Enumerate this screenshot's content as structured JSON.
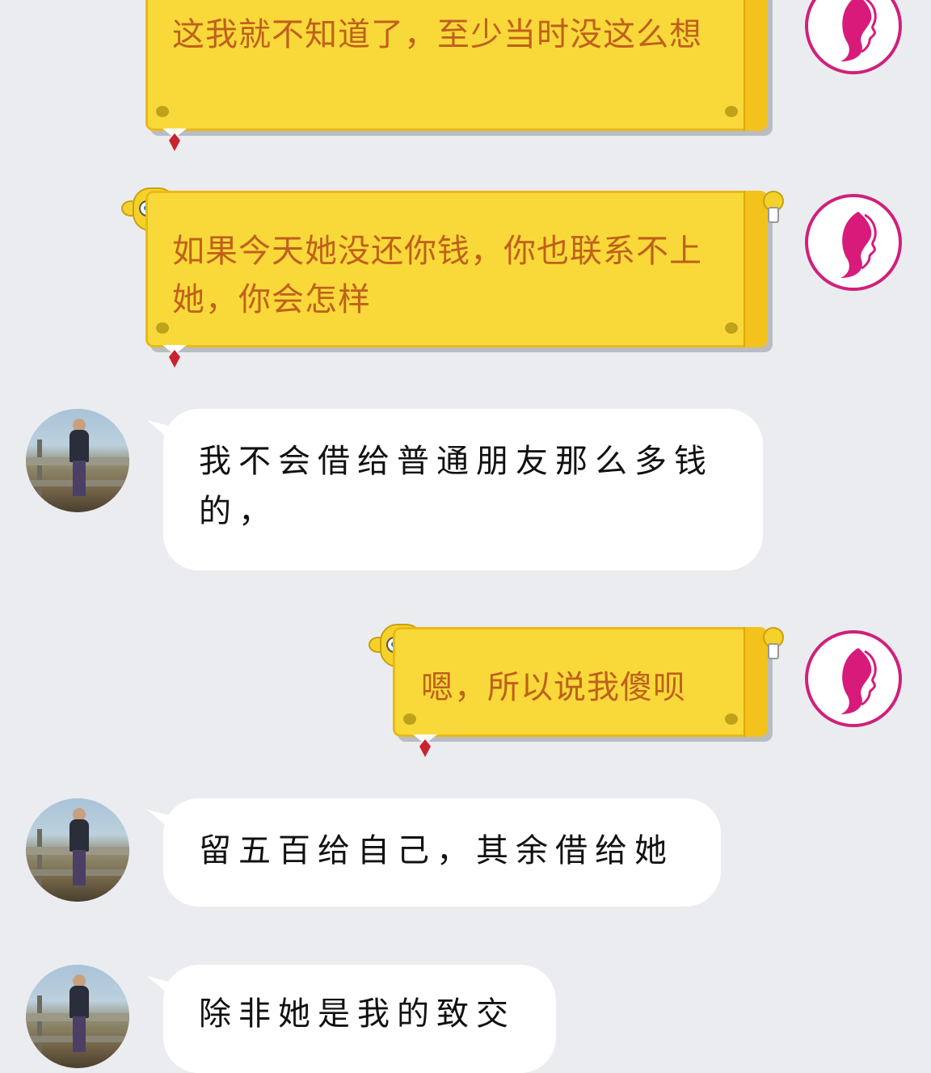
{
  "messages": [
    {
      "side": "right",
      "text": "这我就不知道了，至少当时没这么想"
    },
    {
      "side": "right",
      "text": "如果今天她没还你钱，你也联系不上她，你会怎样"
    },
    {
      "side": "left",
      "text": "我不会借给普通朋友那么多钱的，"
    },
    {
      "side": "right",
      "text": "嗯，所以说我傻呗"
    },
    {
      "side": "left",
      "text": "留五百给自己，其余借给她"
    },
    {
      "side": "left",
      "text": "除非她是我的致交"
    }
  ],
  "colors": {
    "background": "#ebecf0",
    "sent_bubble": "#f9d93a",
    "sent_text": "#c0601a",
    "received_bubble": "#ffffff",
    "avatar_accent": "#d0207a"
  },
  "icons": {
    "self_avatar": "woman-profile-logo-avatar",
    "contact_avatar": "man-photo-avatar",
    "bubble_decoration": "sponge-character-icon"
  }
}
